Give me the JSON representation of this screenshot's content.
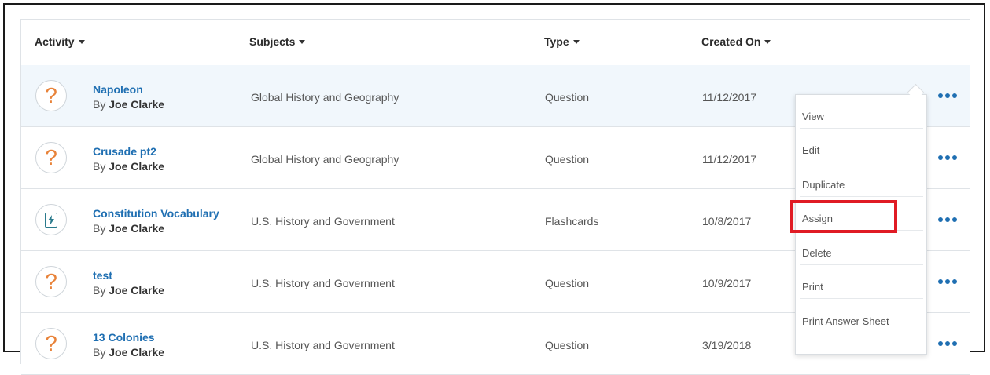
{
  "headers": {
    "activity": "Activity",
    "subjects": "Subjects",
    "type": "Type",
    "created_on": "Created On"
  },
  "rows": [
    {
      "title": "Napoleon",
      "by": "By",
      "author": "Joe Clarke",
      "subject": "Global History and Geography",
      "type": "Question",
      "created": "11/12/2017",
      "icon": "question-mark-icon"
    },
    {
      "title": "Crusade pt2",
      "by": "By",
      "author": "Joe Clarke",
      "subject": "Global History and Geography",
      "type": "Question",
      "created": "11/12/2017",
      "icon": "question-mark-icon"
    },
    {
      "title": "Constitution Vocabulary",
      "by": "By",
      "author": "Joe Clarke",
      "subject": "U.S. History and Government",
      "type": "Flashcards",
      "created": "10/8/2017",
      "icon": "flashcard-icon"
    },
    {
      "title": "test",
      "by": "By",
      "author": "Joe Clarke",
      "subject": "U.S. History and Government",
      "type": "Question",
      "created": "10/9/2017",
      "icon": "question-mark-icon"
    },
    {
      "title": "13 Colonies",
      "by": "By",
      "author": "Joe Clarke",
      "subject": "U.S. History and Government",
      "type": "Question",
      "created": "3/19/2018",
      "icon": "question-mark-icon"
    }
  ],
  "menu": {
    "items": [
      "View",
      "Edit",
      "Duplicate",
      "Assign",
      "Delete",
      "Print",
      "Print Answer Sheet"
    ],
    "highlighted": "Assign"
  },
  "colors": {
    "link": "#1f6fb2",
    "question_icon": "#e8833a",
    "highlight_box": "#e01b24",
    "selected_row": "#f1f7fc"
  }
}
